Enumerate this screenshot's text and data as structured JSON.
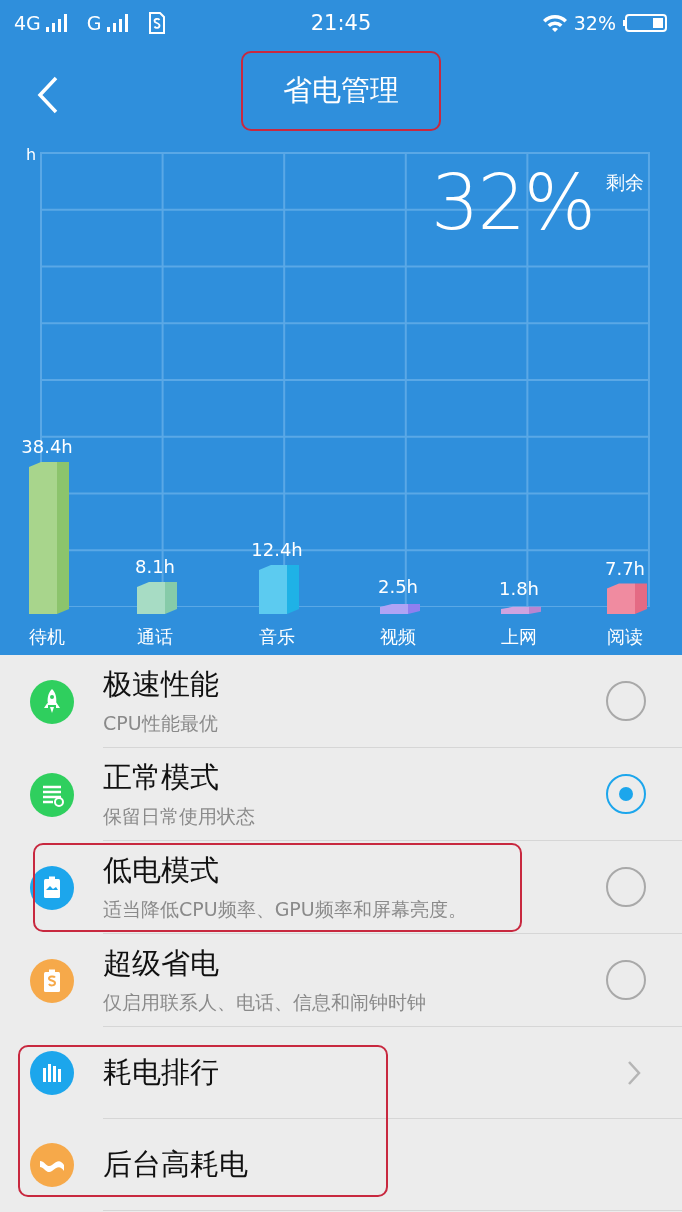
{
  "status_bar": {
    "network_1": "4G",
    "network_2": "G",
    "time": "21:45",
    "battery": "32%"
  },
  "header": {
    "title": "省电管理",
    "highlighted": true
  },
  "chart": {
    "remaining_value": "32%",
    "remaining_label": "剩余",
    "chart_data": {
      "type": "bar",
      "annotations": [
        {
          "text": "h"
        }
      ],
      "categories": [
        "待机",
        "通话",
        "音乐",
        "视频",
        "上网",
        "阅读"
      ],
      "values": [
        38.4,
        8.1,
        12.4,
        2.5,
        1.8,
        7.7
      ],
      "value_labels": [
        "38.4h",
        "8.1h",
        "12.4h",
        "2.5h",
        "1.8h",
        "7.7h"
      ]
    }
  },
  "modes": [
    {
      "kind": "performance",
      "title": "极速性能",
      "subtitle": "CPU性能最优",
      "selected": false,
      "highlighted": false
    },
    {
      "kind": "normal",
      "title": "正常模式",
      "subtitle": "保留日常使用状态",
      "selected": true,
      "highlighted": false
    },
    {
      "kind": "low_power",
      "title": "低电模式",
      "subtitle": "适当降低CPU频率、GPU频率和屏幕亮度。",
      "selected": false,
      "highlighted": true
    },
    {
      "kind": "super_saver",
      "title": "超级省电",
      "subtitle": "仅启用联系人、电话、信息和闹钟时钟",
      "selected": false,
      "highlighted": false
    }
  ],
  "links": {
    "highlighted": true,
    "items": [
      {
        "kind": "ranking",
        "label": "耗电排行",
        "chevron": true
      },
      {
        "kind": "background",
        "label": "后台高耗电",
        "chevron": false
      }
    ]
  }
}
